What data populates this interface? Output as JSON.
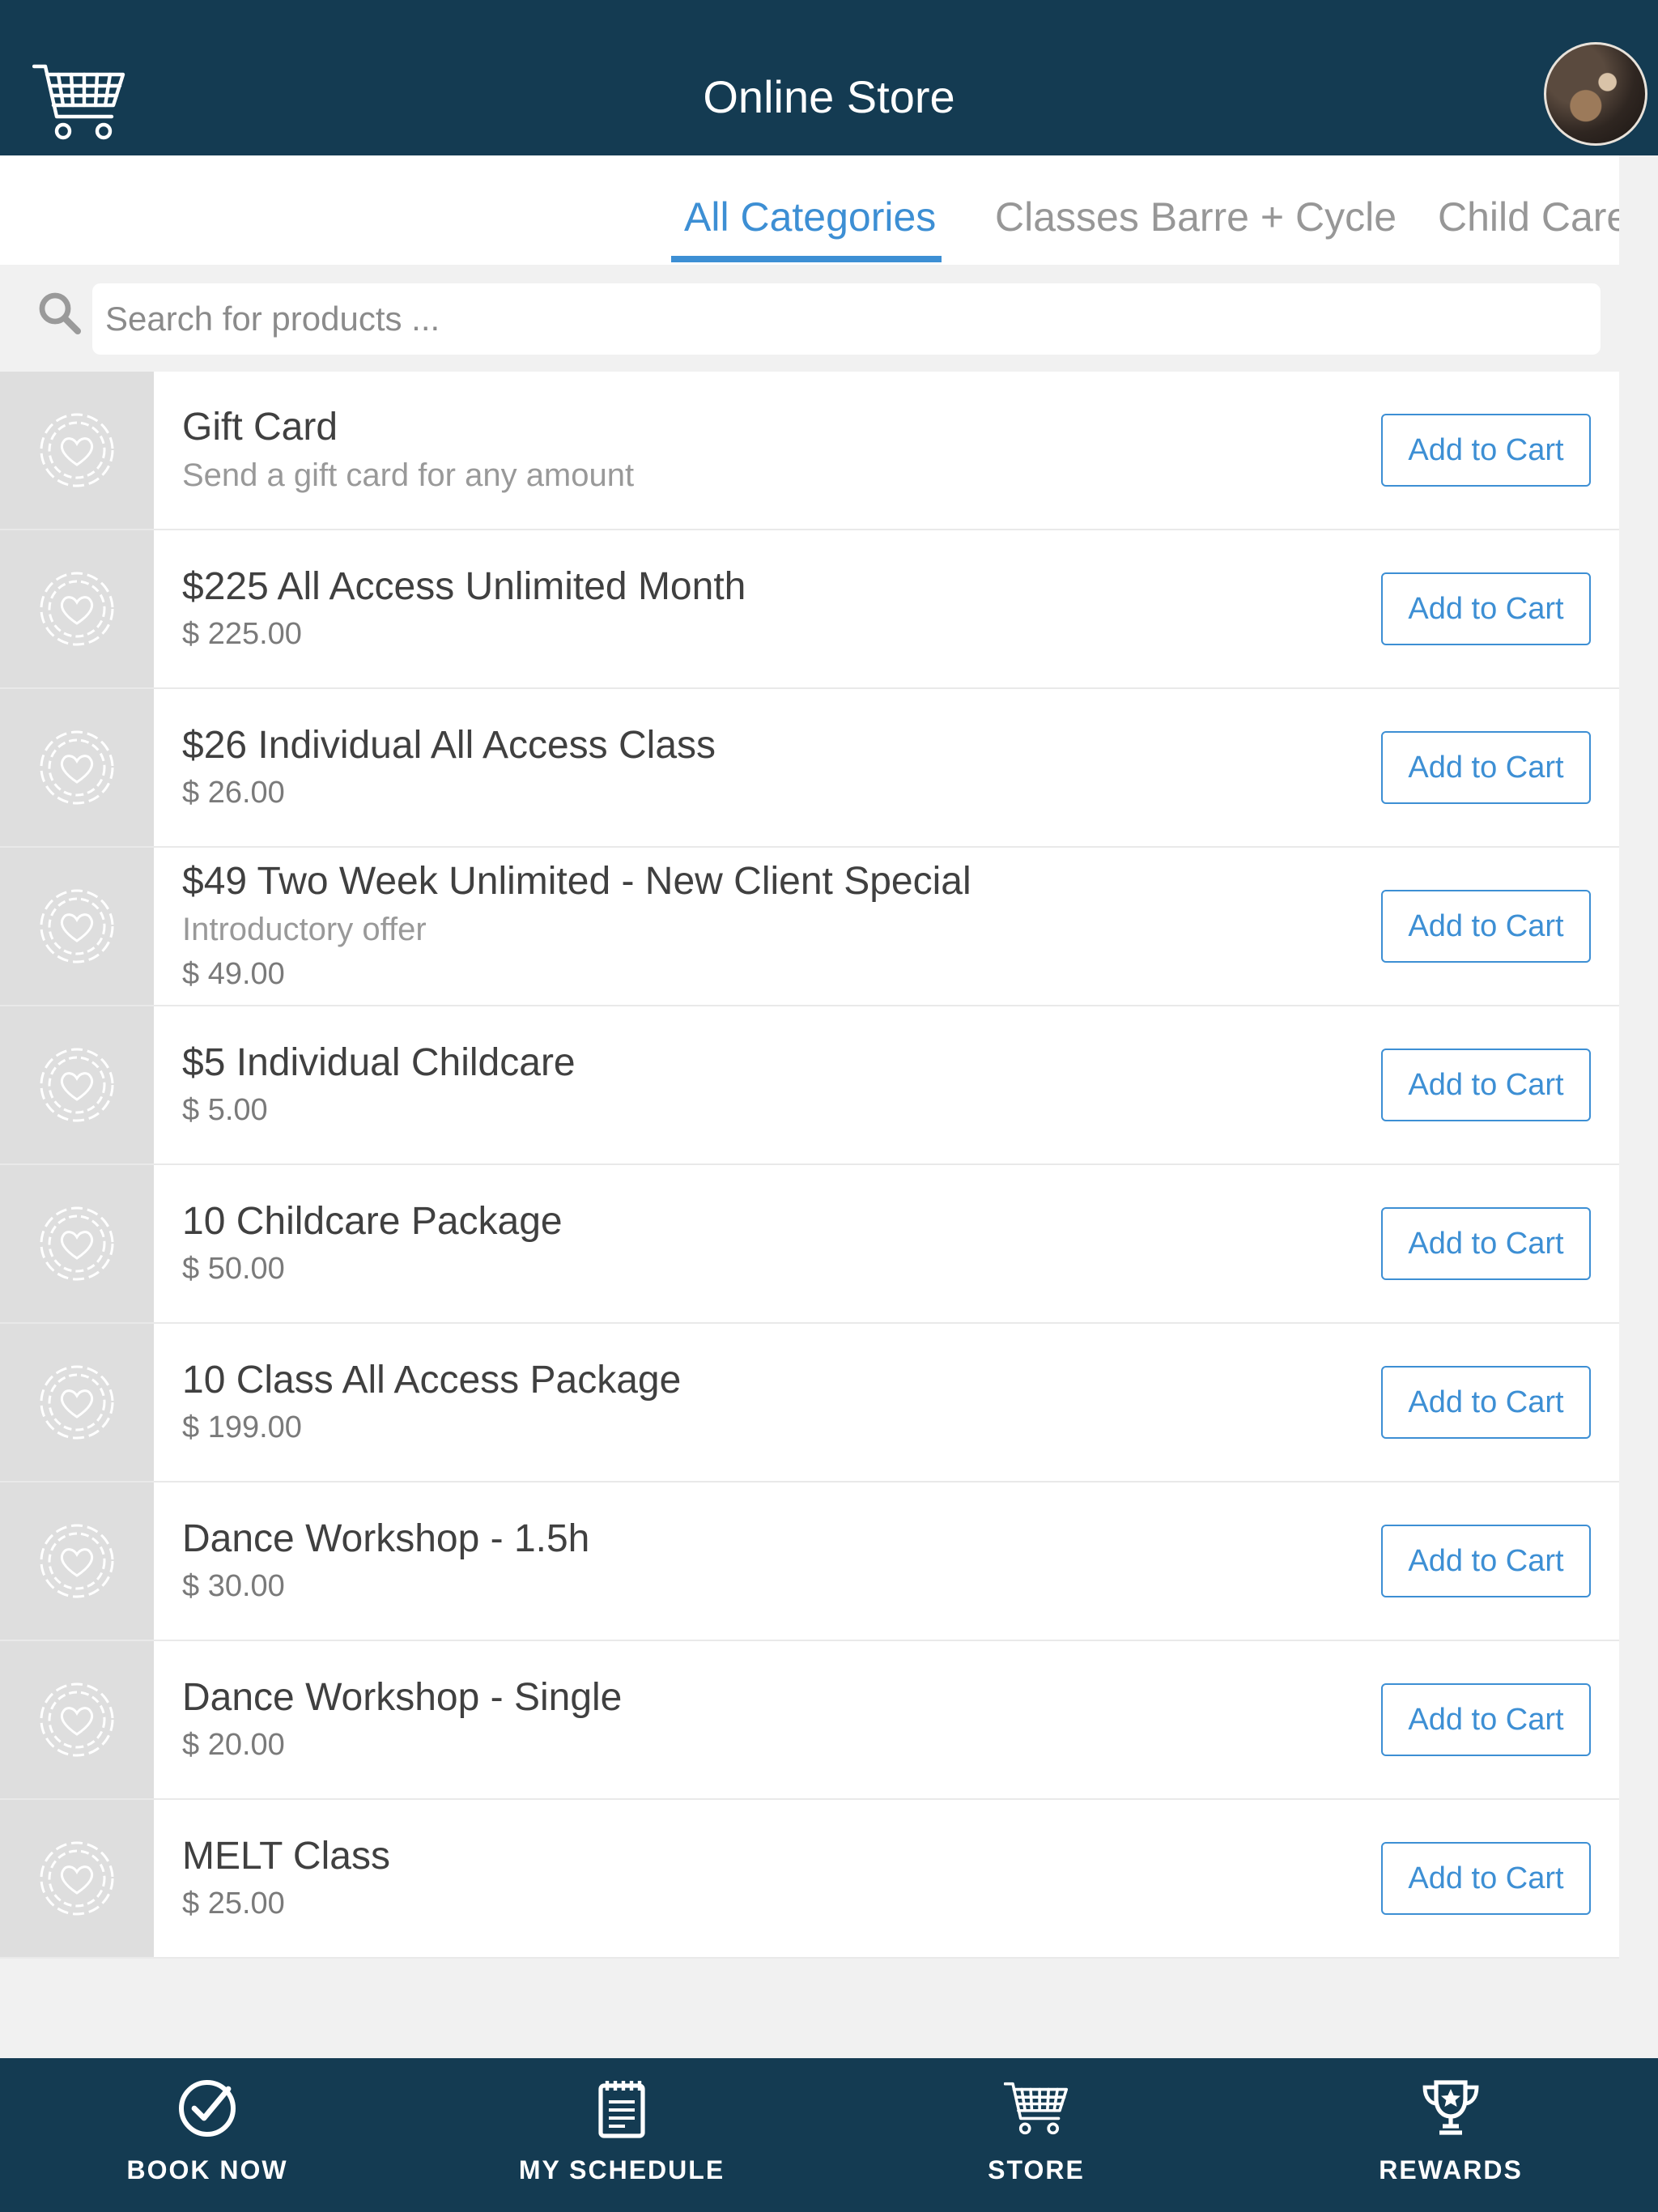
{
  "header": {
    "title": "Online Store"
  },
  "tabs": [
    {
      "label": "All Categories",
      "active": true
    },
    {
      "label": "Classes Barre + Cycle",
      "active": false
    },
    {
      "label": "Child Care",
      "active": false
    }
  ],
  "search": {
    "placeholder": "Search for products ..."
  },
  "products": [
    {
      "name": "Gift Card",
      "desc": "Send a gift card for any amount",
      "price": "",
      "button": "Add to Cart"
    },
    {
      "name": "$225 All Access Unlimited Month",
      "desc": "",
      "price": "$ 225.00",
      "button": "Add to Cart"
    },
    {
      "name": "$26 Individual All Access Class",
      "desc": "",
      "price": "$ 26.00",
      "button": "Add to Cart"
    },
    {
      "name": "$49 Two Week Unlimited - New Client Special",
      "desc": "Introductory offer",
      "price": "$ 49.00",
      "button": "Add to Cart"
    },
    {
      "name": "$5 Individual Childcare",
      "desc": "",
      "price": "$ 5.00",
      "button": "Add to Cart"
    },
    {
      "name": "10 Childcare Package",
      "desc": "",
      "price": "$ 50.00",
      "button": "Add to Cart"
    },
    {
      "name": "10 Class All Access Package",
      "desc": "",
      "price": "$ 199.00",
      "button": "Add to Cart"
    },
    {
      "name": "Dance Workshop - 1.5h",
      "desc": "",
      "price": "$ 30.00",
      "button": "Add to Cart"
    },
    {
      "name": "Dance Workshop - Single",
      "desc": "",
      "price": "$ 20.00",
      "button": "Add to Cart"
    },
    {
      "name": "MELT Class",
      "desc": "",
      "price": "$ 25.00",
      "button": "Add to Cart"
    }
  ],
  "bottom_nav": [
    {
      "label": "BOOK NOW",
      "icon": "check-circle-icon"
    },
    {
      "label": "MY SCHEDULE",
      "icon": "schedule-icon"
    },
    {
      "label": "STORE",
      "icon": "cart-icon"
    },
    {
      "label": "REWARDS",
      "icon": "trophy-icon"
    }
  ],
  "colors": {
    "header_bg": "#143b52",
    "accent": "#3d8fd4",
    "page_bg": "#f1f1f1"
  }
}
